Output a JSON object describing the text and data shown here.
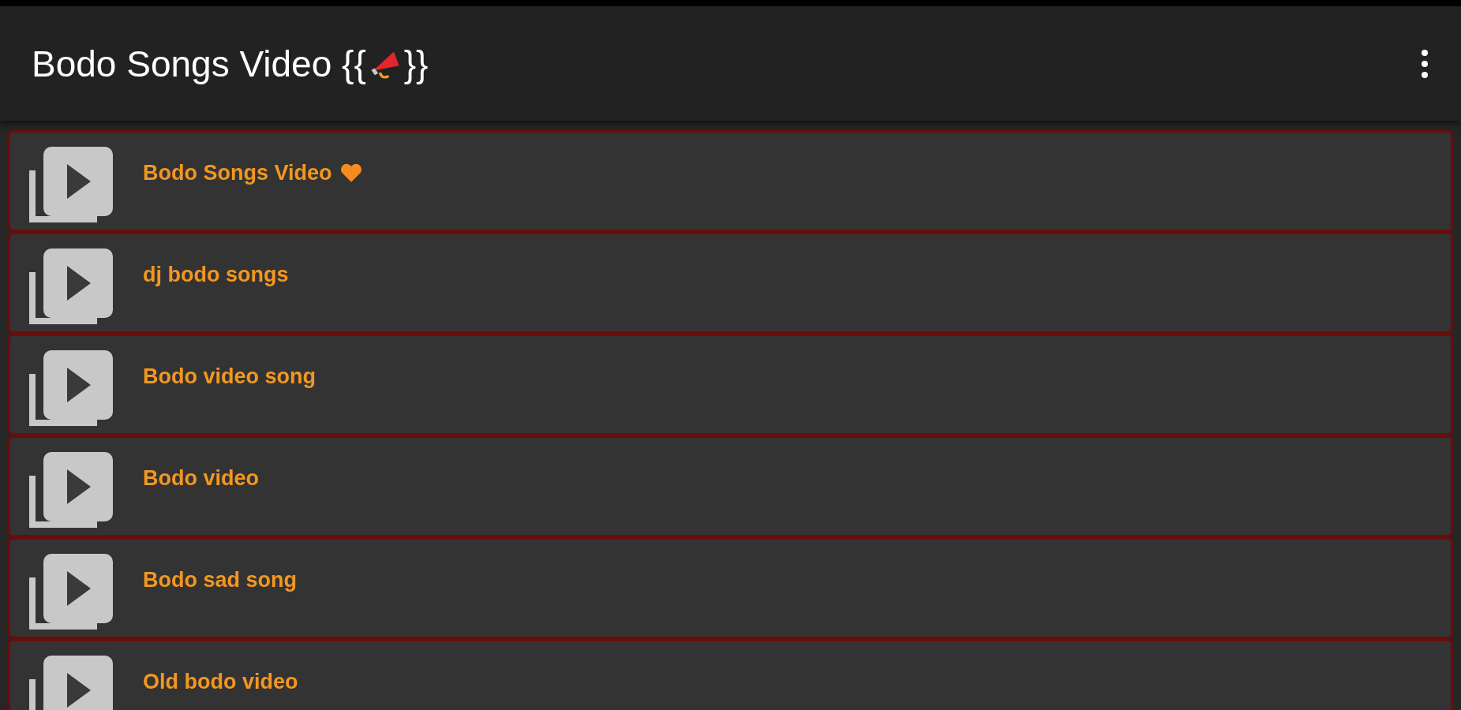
{
  "app_bar": {
    "title_start": "Bodo Songs Video {{",
    "title_end": "}}"
  },
  "videos": [
    {
      "title": "Bodo Songs Video",
      "heart": true
    },
    {
      "title": "dj bodo songs",
      "heart": false
    },
    {
      "title": "Bodo video song",
      "heart": false
    },
    {
      "title": "Bodo video",
      "heart": false
    },
    {
      "title": "Bodo sad song",
      "heart": false
    },
    {
      "title": "Old bodo video",
      "heart": false
    }
  ]
}
